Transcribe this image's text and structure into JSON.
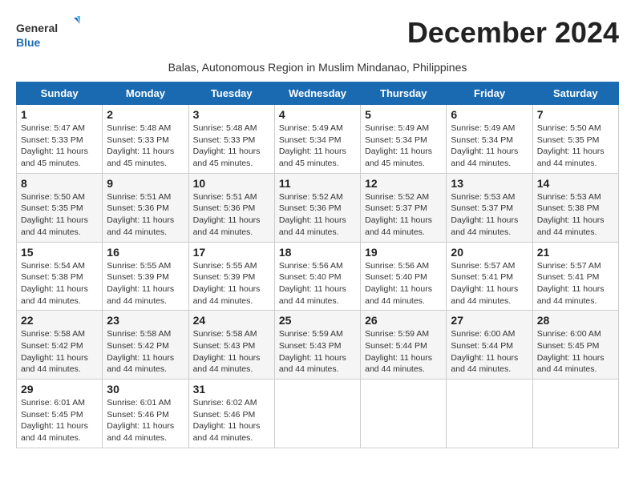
{
  "app": {
    "logo_line1": "General",
    "logo_line2": "Blue"
  },
  "header": {
    "month_title": "December 2024",
    "subtitle": "Balas, Autonomous Region in Muslim Mindanao, Philippines"
  },
  "calendar": {
    "days_of_week": [
      "Sunday",
      "Monday",
      "Tuesday",
      "Wednesday",
      "Thursday",
      "Friday",
      "Saturday"
    ],
    "weeks": [
      [
        null,
        {
          "day": 2,
          "sunrise": "5:48 AM",
          "sunset": "5:33 PM",
          "daylight": "11 hours and 45 minutes."
        },
        {
          "day": 3,
          "sunrise": "5:48 AM",
          "sunset": "5:33 PM",
          "daylight": "11 hours and 45 minutes."
        },
        {
          "day": 4,
          "sunrise": "5:49 AM",
          "sunset": "5:34 PM",
          "daylight": "11 hours and 45 minutes."
        },
        {
          "day": 5,
          "sunrise": "5:49 AM",
          "sunset": "5:34 PM",
          "daylight": "11 hours and 45 minutes."
        },
        {
          "day": 6,
          "sunrise": "5:49 AM",
          "sunset": "5:34 PM",
          "daylight": "11 hours and 44 minutes."
        },
        {
          "day": 7,
          "sunrise": "5:50 AM",
          "sunset": "5:35 PM",
          "daylight": "11 hours and 44 minutes."
        }
      ],
      [
        {
          "day": 1,
          "sunrise": "5:47 AM",
          "sunset": "5:33 PM",
          "daylight": "11 hours and 45 minutes."
        },
        {
          "day": 8,
          "sunrise": "5:50 AM",
          "sunset": "5:35 PM",
          "daylight": "11 hours and 44 minutes."
        },
        {
          "day": 9,
          "sunrise": "5:51 AM",
          "sunset": "5:36 PM",
          "daylight": "11 hours and 44 minutes."
        },
        {
          "day": 10,
          "sunrise": "5:51 AM",
          "sunset": "5:36 PM",
          "daylight": "11 hours and 44 minutes."
        },
        {
          "day": 11,
          "sunrise": "5:52 AM",
          "sunset": "5:36 PM",
          "daylight": "11 hours and 44 minutes."
        },
        {
          "day": 12,
          "sunrise": "5:52 AM",
          "sunset": "5:37 PM",
          "daylight": "11 hours and 44 minutes."
        },
        {
          "day": 13,
          "sunrise": "5:53 AM",
          "sunset": "5:37 PM",
          "daylight": "11 hours and 44 minutes."
        },
        {
          "day": 14,
          "sunrise": "5:53 AM",
          "sunset": "5:38 PM",
          "daylight": "11 hours and 44 minutes."
        }
      ],
      [
        {
          "day": 15,
          "sunrise": "5:54 AM",
          "sunset": "5:38 PM",
          "daylight": "11 hours and 44 minutes."
        },
        {
          "day": 16,
          "sunrise": "5:55 AM",
          "sunset": "5:39 PM",
          "daylight": "11 hours and 44 minutes."
        },
        {
          "day": 17,
          "sunrise": "5:55 AM",
          "sunset": "5:39 PM",
          "daylight": "11 hours and 44 minutes."
        },
        {
          "day": 18,
          "sunrise": "5:56 AM",
          "sunset": "5:40 PM",
          "daylight": "11 hours and 44 minutes."
        },
        {
          "day": 19,
          "sunrise": "5:56 AM",
          "sunset": "5:40 PM",
          "daylight": "11 hours and 44 minutes."
        },
        {
          "day": 20,
          "sunrise": "5:57 AM",
          "sunset": "5:41 PM",
          "daylight": "11 hours and 44 minutes."
        },
        {
          "day": 21,
          "sunrise": "5:57 AM",
          "sunset": "5:41 PM",
          "daylight": "11 hours and 44 minutes."
        }
      ],
      [
        {
          "day": 22,
          "sunrise": "5:58 AM",
          "sunset": "5:42 PM",
          "daylight": "11 hours and 44 minutes."
        },
        {
          "day": 23,
          "sunrise": "5:58 AM",
          "sunset": "5:42 PM",
          "daylight": "11 hours and 44 minutes."
        },
        {
          "day": 24,
          "sunrise": "5:58 AM",
          "sunset": "5:43 PM",
          "daylight": "11 hours and 44 minutes."
        },
        {
          "day": 25,
          "sunrise": "5:59 AM",
          "sunset": "5:43 PM",
          "daylight": "11 hours and 44 minutes."
        },
        {
          "day": 26,
          "sunrise": "5:59 AM",
          "sunset": "5:44 PM",
          "daylight": "11 hours and 44 minutes."
        },
        {
          "day": 27,
          "sunrise": "6:00 AM",
          "sunset": "5:44 PM",
          "daylight": "11 hours and 44 minutes."
        },
        {
          "day": 28,
          "sunrise": "6:00 AM",
          "sunset": "5:45 PM",
          "daylight": "11 hours and 44 minutes."
        }
      ],
      [
        {
          "day": 29,
          "sunrise": "6:01 AM",
          "sunset": "5:45 PM",
          "daylight": "11 hours and 44 minutes."
        },
        {
          "day": 30,
          "sunrise": "6:01 AM",
          "sunset": "5:46 PM",
          "daylight": "11 hours and 44 minutes."
        },
        {
          "day": 31,
          "sunrise": "6:02 AM",
          "sunset": "5:46 PM",
          "daylight": "11 hours and 44 minutes."
        },
        null,
        null,
        null,
        null
      ]
    ]
  }
}
